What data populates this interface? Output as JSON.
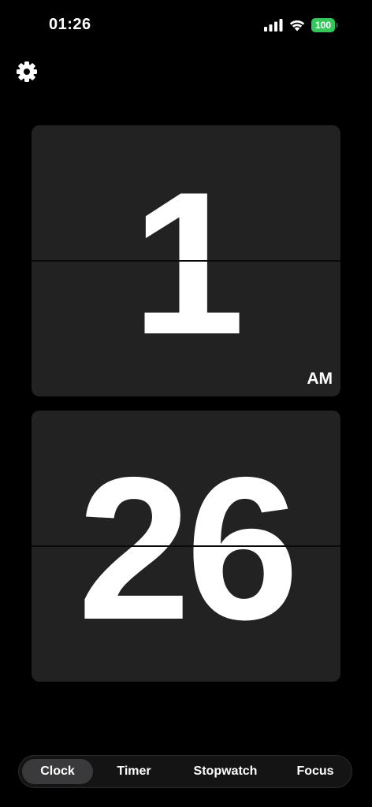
{
  "status_bar": {
    "time": "01:26",
    "battery_level": "100",
    "battery_color": "#34c759",
    "icons": [
      "signal-icon",
      "wifi-icon",
      "battery-icon"
    ]
  },
  "toolbar": {
    "settings_icon": "gear-icon"
  },
  "clock": {
    "hours": "1",
    "minutes": "26",
    "period": "AM"
  },
  "tabs": [
    {
      "label": "Clock",
      "active": true
    },
    {
      "label": "Timer",
      "active": false
    },
    {
      "label": "Stopwatch",
      "active": false
    },
    {
      "label": "Focus",
      "active": false
    }
  ],
  "colors": {
    "background": "#000000",
    "card": "#222222",
    "active_tab": "#3a3a3c"
  }
}
